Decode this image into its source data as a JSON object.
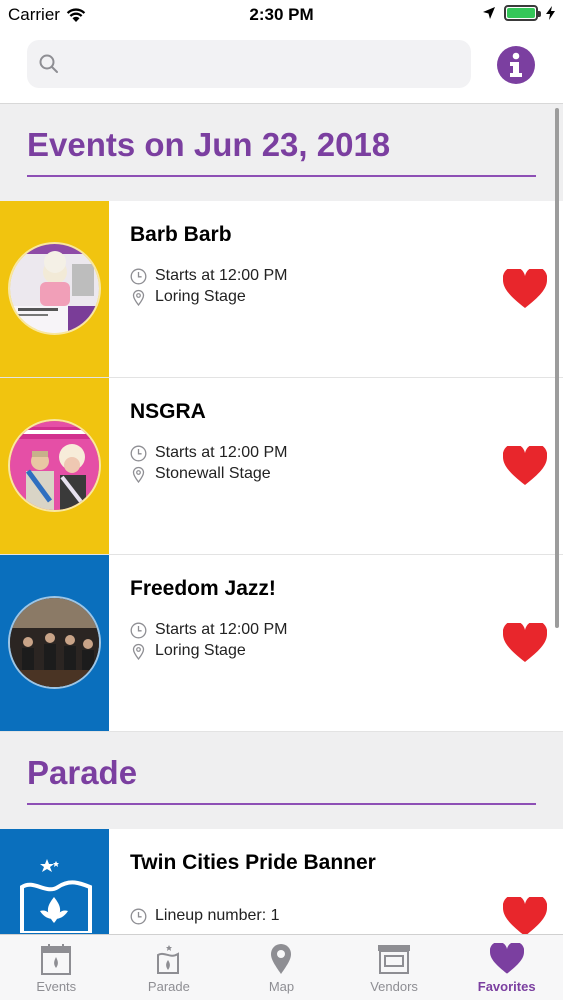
{
  "status_bar": {
    "carrier": "Carrier",
    "time": "2:30 PM"
  },
  "search": {
    "placeholder": "",
    "value": ""
  },
  "sections": [
    {
      "title": "Events on Jun 23, 2018",
      "rows": [
        {
          "title": "Barb Barb",
          "line1": "Starts at 12:00 PM",
          "line2": "Loring Stage",
          "stripe_color": "#f1c40f",
          "favorite": true
        },
        {
          "title": "NSGRA",
          "line1": "Starts at 12:00 PM",
          "line2": "Stonewall Stage",
          "stripe_color": "#f1c40f",
          "favorite": true
        },
        {
          "title": "Freedom Jazz!",
          "line1": "Starts at 12:00 PM",
          "line2": "Loring Stage",
          "stripe_color": "#0a6fbd",
          "favorite": true
        }
      ]
    },
    {
      "title": "Parade",
      "rows": [
        {
          "title": "Twin Cities Pride Banner",
          "line1": "Lineup number: 1",
          "stripe_color": "#0a6fbd",
          "favorite": true
        }
      ]
    }
  ],
  "tabs": [
    {
      "label": "Events",
      "icon": "calendar-icon",
      "active": false
    },
    {
      "label": "Parade",
      "icon": "flag-icon",
      "active": false
    },
    {
      "label": "Map",
      "icon": "map-pin-icon",
      "active": false
    },
    {
      "label": "Vendors",
      "icon": "storefront-icon",
      "active": false
    },
    {
      "label": "Favorites",
      "icon": "heart-icon",
      "active": true
    }
  ],
  "colors": {
    "accent": "#7b3fa0",
    "heart": "#e8262c",
    "yellow": "#f1c40f",
    "blue": "#0a6fbd"
  }
}
